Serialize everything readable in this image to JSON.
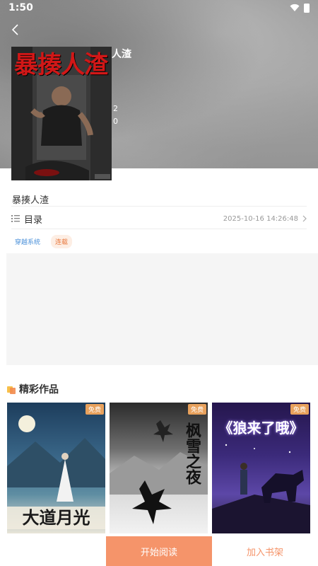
{
  "status_bar": {
    "time": "1:50"
  },
  "book": {
    "cover_title": "暴揍人渣",
    "name_header_partial": "人渣",
    "name": "暴揍人渣",
    "cover_overflow_lines": [
      "2",
      "0"
    ]
  },
  "toc": {
    "label": "目录",
    "updated": "2025-10-16 14:26:48"
  },
  "tags": [
    "穿越系统",
    "连载"
  ],
  "featured": {
    "title": "精彩作品",
    "items": [
      {
        "title": "大道月光",
        "badge": "免费"
      },
      {
        "title": "枫雪之夜",
        "badge": "免费"
      },
      {
        "title": "《狼来了哦》",
        "badge": "免费"
      }
    ]
  },
  "actions": {
    "start_reading": "开始阅读",
    "add_to_shelf": "加入书架"
  },
  "colors": {
    "accent": "#f5946a",
    "tag_blue": "#4a90d9",
    "tag_orange": "#e8773c",
    "badge": "#e8a15c"
  }
}
